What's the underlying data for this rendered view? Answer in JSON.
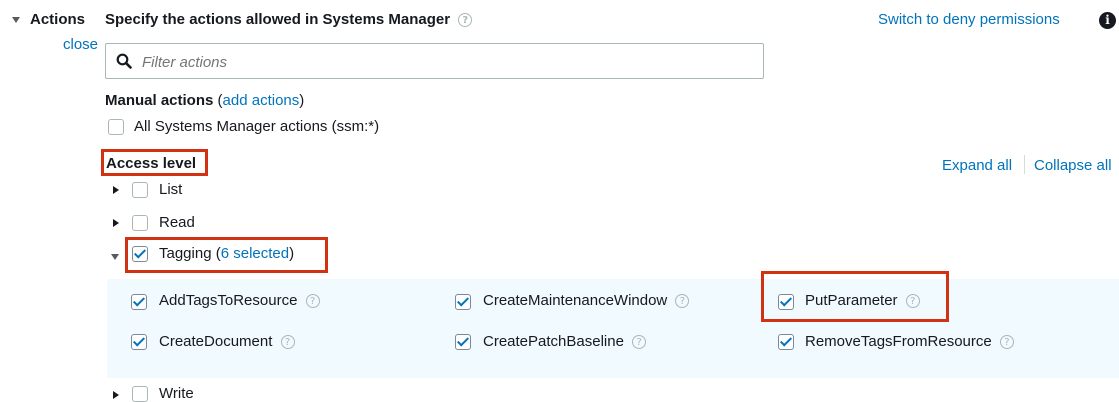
{
  "section": {
    "title": "Actions",
    "close_label": "close",
    "heading": "Specify the actions allowed in Systems Manager",
    "switch_link": "Switch to deny permissions"
  },
  "search": {
    "placeholder": "Filter actions"
  },
  "manual": {
    "label": "Manual actions",
    "paren_open": "(",
    "add_link": "add actions",
    "paren_close": ")",
    "all_label": "All Systems Manager actions (ssm:*)"
  },
  "access": {
    "label": "Access level",
    "expand_all": "Expand all",
    "collapse_all": "Collapse all",
    "groups": {
      "list": "List",
      "read": "Read",
      "tagging": "Tagging",
      "tagging_paren_open": "(",
      "tagging_selected": "6 selected",
      "tagging_paren_close": ")",
      "write": "Write"
    },
    "tagging_actions": {
      "add_tags": "AddTagsToResource",
      "create_maint": "CreateMaintenanceWindow",
      "put_param": "PutParameter",
      "create_doc": "CreateDocument",
      "create_patch": "CreatePatchBaseline",
      "remove_tags": "RemoveTagsFromResource"
    }
  },
  "icons": {
    "help": "question-circle-icon",
    "info": "info-circle-icon",
    "search": "search-icon"
  },
  "colors": {
    "link": "#0073bb",
    "highlight": "#d13212",
    "panel_bg": "#f1faff"
  }
}
